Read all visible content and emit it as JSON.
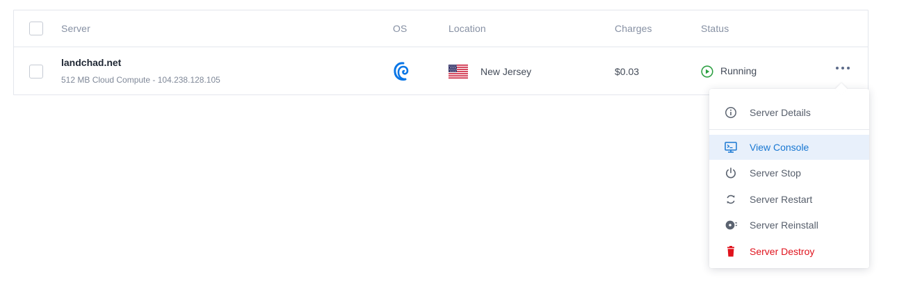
{
  "table": {
    "columns": {
      "server": "Server",
      "os": "OS",
      "location": "Location",
      "charges": "Charges",
      "status": "Status"
    },
    "rows": [
      {
        "name": "landchad.net",
        "details": "512 MB Cloud Compute - 104.238.128.105",
        "os_icon": "debian-icon",
        "location_flag": "us-flag-icon",
        "location": "New Jersey",
        "charges": "$0.03",
        "status": "Running",
        "status_icon": "play-circle-icon"
      }
    ]
  },
  "colors": {
    "accent": "#1877d2",
    "status_running": "#2ea043",
    "danger": "#e0131d",
    "os_icon": "#0a76e6"
  },
  "menu": {
    "items": [
      {
        "label": "Server Details",
        "icon": "info-circle-icon"
      },
      {
        "label": "View Console",
        "icon": "monitor-icon"
      },
      {
        "label": "Server Stop",
        "icon": "power-icon"
      },
      {
        "label": "Server Restart",
        "icon": "restart-icon"
      },
      {
        "label": "Server Reinstall",
        "icon": "disc-icon"
      },
      {
        "label": "Server Destroy",
        "icon": "trash-icon"
      }
    ]
  }
}
